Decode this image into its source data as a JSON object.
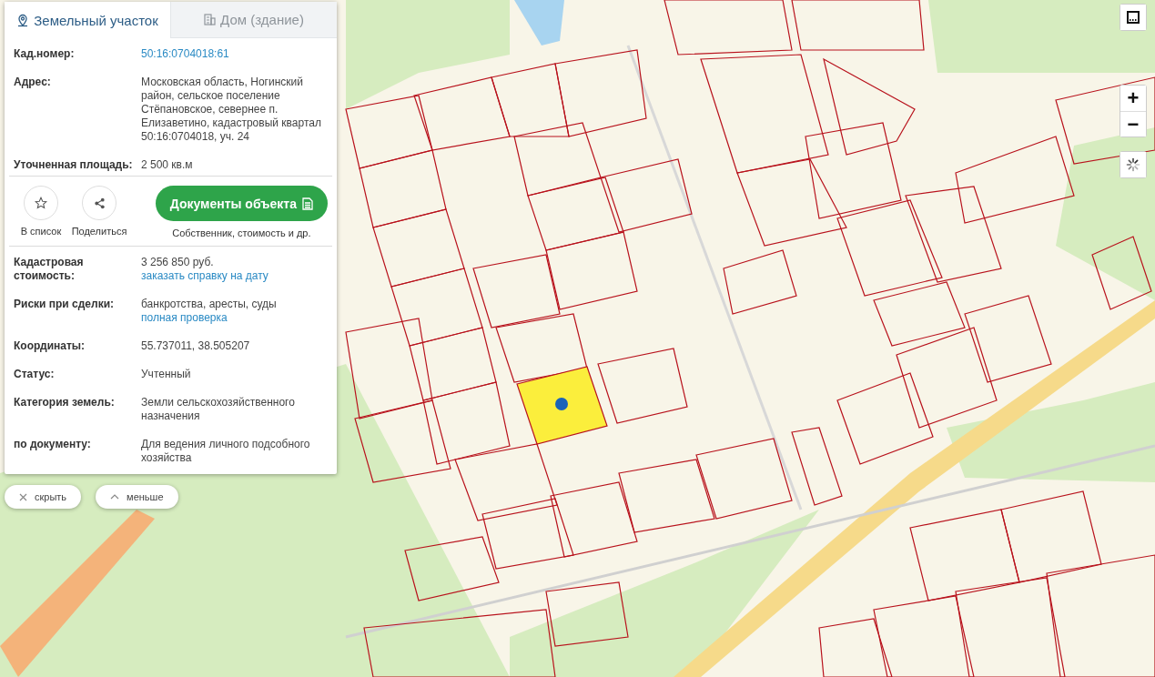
{
  "tabs": [
    {
      "label": "Земельный участок",
      "selected": true
    },
    {
      "label": "Дом (здание)",
      "selected": false
    }
  ],
  "summary": [
    {
      "label": "Кад.номер:",
      "value": "50:16:0704018:61",
      "kind": "link"
    },
    {
      "label": "Адрес:",
      "value": "Московская область, Ногинский район, сельское поселение Стёпановское, севернее п. Елизаветино, кадастровый квартал 50:16:0704018, уч. 24",
      "kind": "text"
    },
    {
      "label": "Уточненная площадь:",
      "value": "2 500 кв.м",
      "kind": "text"
    }
  ],
  "actions": [
    {
      "label": "В список"
    },
    {
      "label": "Поделиться"
    }
  ],
  "documents": {
    "label": "Документы объекта",
    "caption": "Собственник, стоимость и др."
  },
  "details": [
    {
      "label": "Кадастровая стоимость:",
      "value": "3 256 850 руб.",
      "link": "заказать справку на дату"
    },
    {
      "label": "Риски при сделки:",
      "value": "банкротства, аресты, суды",
      "link": "полная проверка"
    },
    {
      "label": "Координаты:",
      "value": "55.737011, 38.505207"
    },
    {
      "label": "Статус:",
      "value": "Учтенный"
    },
    {
      "label": "Категория земель:",
      "value": "Земли сельскохозяйственного назначения"
    },
    {
      "label": "по документу:",
      "value": "Для ведения личного подсобного хозяйства"
    }
  ],
  "panel_buttons": [
    {
      "label": "скрыть"
    },
    {
      "label": "меньше"
    }
  ],
  "zoom": [
    {
      "label": "+"
    },
    {
      "label": "−"
    }
  ]
}
